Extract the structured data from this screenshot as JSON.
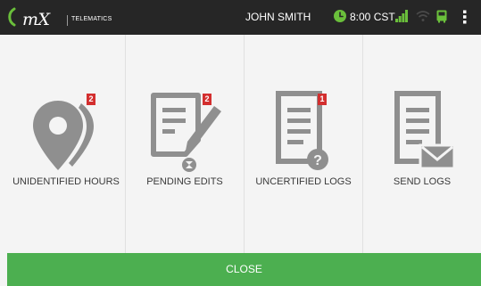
{
  "header": {
    "logo_text": "mX",
    "logo_subtitle": "TELEMATICS",
    "user_name": "JOHN SMITH",
    "time": "8:00 CST",
    "icons": [
      "clock-icon",
      "signal-icon",
      "wifi-icon",
      "device-icon",
      "menu-icon"
    ]
  },
  "tiles": [
    {
      "label": "UNIDENTIFIED HOURS",
      "badge": "2",
      "icon": "location-pin-icon"
    },
    {
      "label": "PENDING EDITS",
      "badge": "2",
      "icon": "edit-document-icon"
    },
    {
      "label": "UNCERTIFIED LOGS",
      "badge": "1",
      "icon": "document-question-icon"
    },
    {
      "label": "SEND LOGS",
      "badge": null,
      "icon": "document-mail-icon"
    }
  ],
  "footer": {
    "close_label": "CLOSE"
  },
  "colors": {
    "topbar": "#262626",
    "accent_green": "#4caf50",
    "badge_red": "#d32f2f",
    "icon_gray": "#8f8f8f",
    "status_green": "#6abf3b"
  }
}
